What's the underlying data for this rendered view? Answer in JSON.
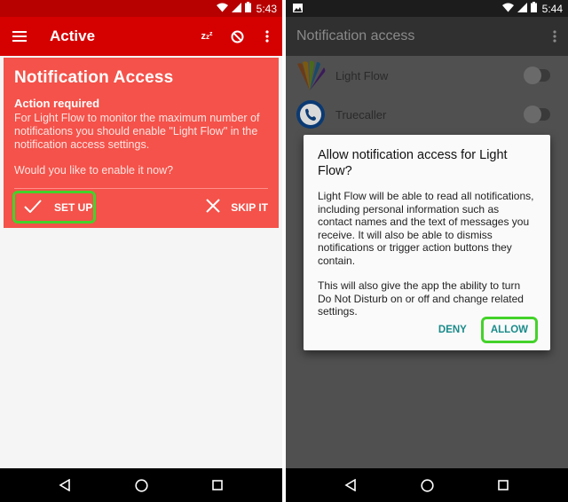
{
  "left": {
    "status": {
      "time": "5:43"
    },
    "appbar": {
      "title": "Active",
      "snooze_label": "z",
      "snooze_sup": "z",
      "snooze_sup2": "z"
    },
    "card": {
      "title": "Notification Access",
      "subtitle": "Action required",
      "body": "For Light Flow to monitor the maximum number of notifications you should enable \"Light Flow\" in the notification access settings.",
      "question": "Would you like to enable it now?",
      "setup_label": "SET UP",
      "skip_label": "SKIP IT"
    }
  },
  "right": {
    "status": {
      "time": "5:44"
    },
    "appbar": {
      "title": "Notification access"
    },
    "apps": [
      {
        "name": "Light Flow",
        "enabled": false
      },
      {
        "name": "Truecaller",
        "icon_text": "true",
        "enabled": false
      }
    ],
    "dialog": {
      "title": "Allow notification access for Light Flow?",
      "body1": "Light Flow will be able to read all notifications, including personal information such as contact names and the text of messages you receive. It will also be able to dismiss notifications or trigger action buttons they contain.",
      "body2": "This will also give the app the ability to turn Do Not Disturb on or off and change related settings.",
      "deny_label": "DENY",
      "allow_label": "ALLOW"
    }
  },
  "colors": {
    "accent_red": "#d50000",
    "card_red": "#f4524a",
    "highlight_green": "#44d22a",
    "dialog_button_teal": "#1a8a8a"
  }
}
